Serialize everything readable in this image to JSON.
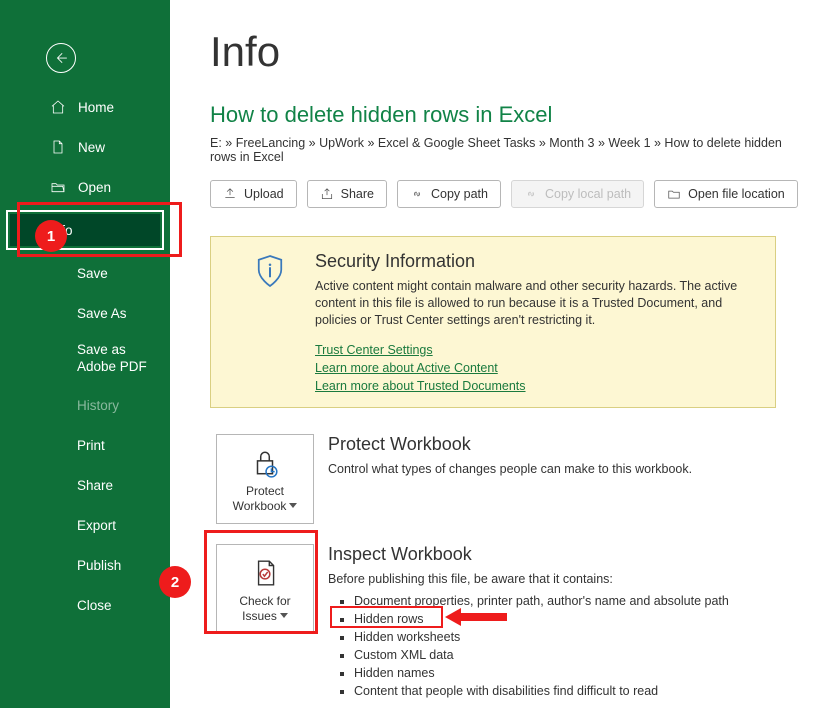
{
  "sidebar": {
    "home": "Home",
    "new": "New",
    "open": "Open",
    "info": "Info",
    "save": "Save",
    "saveAs": "Save As",
    "saveAdobe": "Save as Adobe PDF",
    "history": "History",
    "print": "Print",
    "share": "Share",
    "export": "Export",
    "publish": "Publish",
    "close": "Close"
  },
  "page": {
    "title": "Info",
    "docTitle": "How to delete hidden rows in Excel",
    "breadcrumb": "E: » FreeLancing » UpWork » Excel & Google Sheet Tasks » Month 3 » Week 1 » How to delete hidden rows in Excel"
  },
  "actions": {
    "upload": "Upload",
    "share": "Share",
    "copyPath": "Copy path",
    "copyLocalPath": "Copy local path",
    "openLocation": "Open file location"
  },
  "security": {
    "heading": "Security Information",
    "body": "Active content might contain malware and other security hazards. The active content in this file is allowed to run because it is a Trusted Document, and policies or Trust Center settings aren't restricting it.",
    "link1": "Trust Center Settings",
    "link2": "Learn more about Active Content",
    "link3": "Learn more about Trusted Documents"
  },
  "protect": {
    "btnLine1": "Protect",
    "btnLine2": "Workbook",
    "heading": "Protect Workbook",
    "body": "Control what types of changes people can make to this workbook."
  },
  "inspect": {
    "btnLine1": "Check for",
    "btnLine2": "Issues",
    "heading": "Inspect Workbook",
    "lead": "Before publishing this file, be aware that it contains:",
    "items": [
      "Document properties, printer path, author's name and absolute path",
      "Hidden rows",
      "Hidden worksheets",
      "Custom XML data",
      "Hidden names",
      "Content that people with disabilities find difficult to read"
    ]
  },
  "annotations": {
    "badge1": "1",
    "badge2": "2"
  }
}
